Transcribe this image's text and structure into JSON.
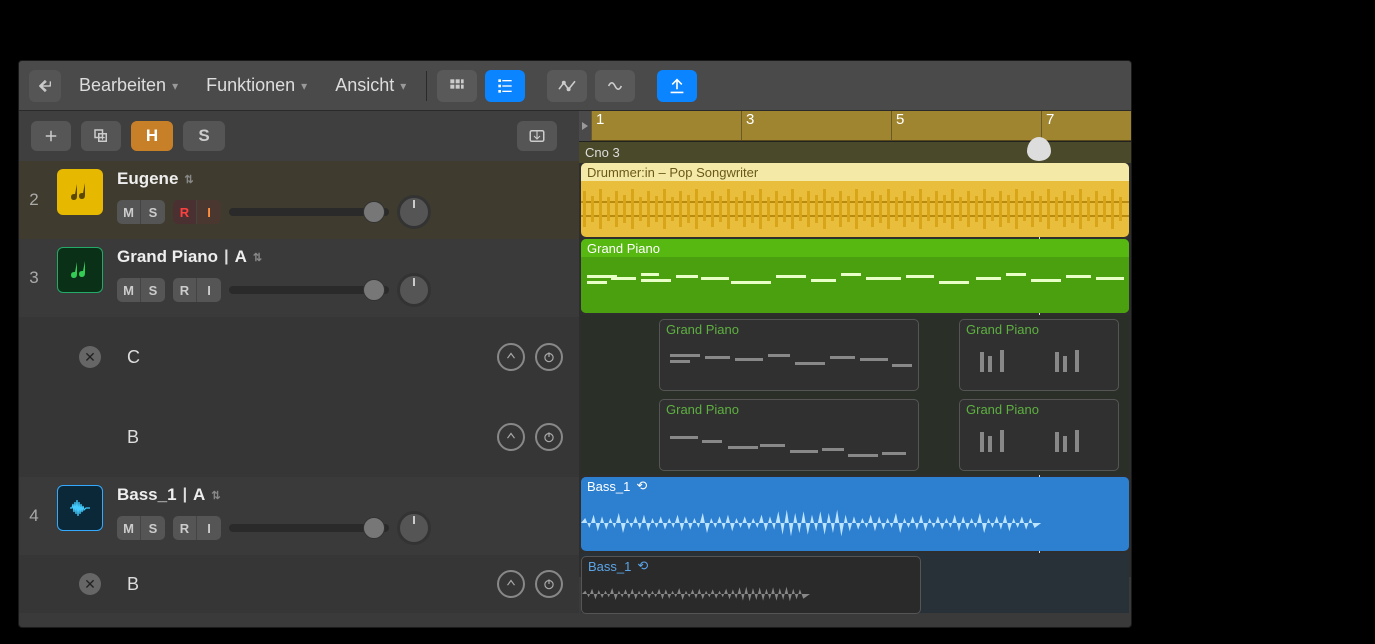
{
  "menubar": {
    "back_icon": "back-arrow",
    "menus": [
      "Bearbeiten",
      "Funktionen",
      "Ansicht"
    ]
  },
  "view_icons": [
    "grid-icon",
    "list-icon",
    "automation-icon",
    "flex-icon",
    "catch-icon"
  ],
  "toolbar2": {
    "add": "add-track",
    "duplicate": "duplicate-track",
    "hide": "H",
    "solo": "S",
    "inbox": "global-tracks-icon"
  },
  "ruler": {
    "bars": [
      1,
      3,
      5,
      7
    ],
    "marker": "Cno 3",
    "playhead_bar": 6.8
  },
  "tracks": [
    {
      "num": 2,
      "icon": "yellow",
      "name": "Eugene",
      "take": "",
      "buttons": [
        "M",
        "S",
        "R",
        "I"
      ],
      "record_armed": true
    },
    {
      "num": 3,
      "icon": "green",
      "name": "Grand Piano",
      "take": "A",
      "buttons": [
        "M",
        "S",
        "R",
        "I"
      ],
      "record_armed": false,
      "takes": [
        {
          "label": "C",
          "close": true
        },
        {
          "label": "B",
          "close": false
        }
      ]
    },
    {
      "num": 4,
      "icon": "blue",
      "name": "Bass_1",
      "take": "A",
      "buttons": [
        "M",
        "S",
        "R",
        "I"
      ],
      "record_armed": false,
      "takes": [
        {
          "label": "B",
          "close": true
        }
      ]
    }
  ],
  "regions": {
    "drummer": {
      "label": "Drummer:in – Pop Songwriter"
    },
    "grand_piano_main": {
      "label": "Grand Piano"
    },
    "grand_piano_takes": [
      {
        "label": "Grand Piano"
      },
      {
        "label": "Grand Piano"
      },
      {
        "label": "Grand Piano"
      },
      {
        "label": "Grand Piano"
      }
    ],
    "bass_main": {
      "label": "Bass_1"
    },
    "bass_take": {
      "label": "Bass_1"
    }
  }
}
